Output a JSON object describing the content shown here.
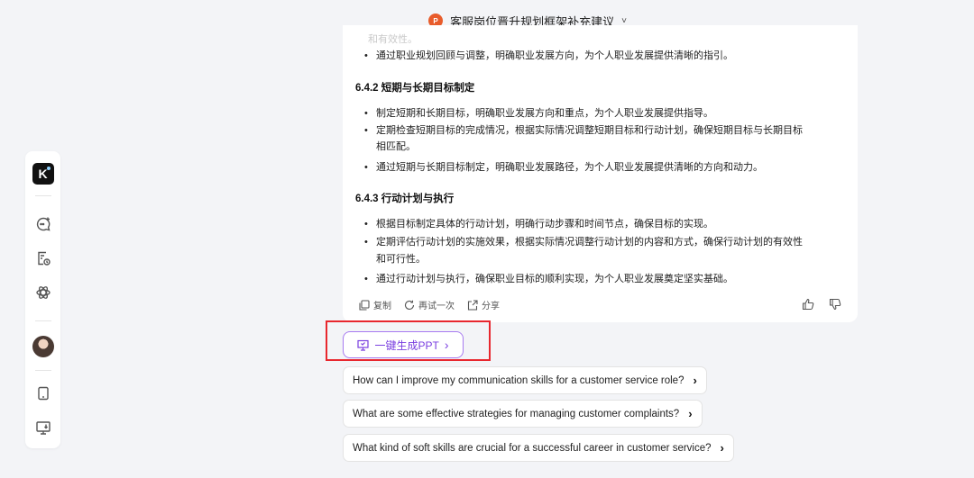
{
  "header": {
    "doc_icon_label": "P",
    "title": "客服岗位晋升规划框架补充建议",
    "chevron": "˅"
  },
  "sidebar": {
    "logo_text": "K"
  },
  "message": {
    "faded_text": "和有效性。",
    "intro_bullet": "通过职业规划回顾与调整，明确职业发展方向，为个人职业发展提供清晰的指引。",
    "sections": [
      {
        "heading": "6.4.2 短期与长期目标制定",
        "bullets": [
          [
            "制定短期和长期目标，明确职业发展方向和重点，为个人职业发展提供指导。"
          ],
          [
            "定期检查短期目标的完成情况，根据实际情况调整短期目标和行动计划，确保短期目标与长期目标",
            "相匹配。"
          ],
          [
            "通过短期与长期目标制定，明确职业发展路径，为个人职业发展提供清晰的方向和动力。"
          ]
        ]
      },
      {
        "heading": "6.4.3 行动计划与执行",
        "bullets": [
          [
            "根据目标制定具体的行动计划，明确行动步骤和时间节点，确保目标的实现。"
          ],
          [
            "定期评估行动计划的实施效果，根据实际情况调整行动计划的内容和方式，确保行动计划的有效性",
            "和可行性。"
          ],
          [
            "通过行动计划与执行，确保职业目标的顺利实现，为个人职业发展奠定坚实基础。"
          ]
        ]
      }
    ],
    "actions": {
      "copy": "复制",
      "retry": "再试一次",
      "share": "分享"
    }
  },
  "ppt_button": {
    "label": "一键生成PPT",
    "arrow": "›"
  },
  "suggestions": [
    "How can I improve my communication skills for a customer service role?",
    "What are some effective strategies for managing customer complaints?",
    "What kind of soft skills are crucial for a successful career in customer service?"
  ],
  "suggestion_arrow": "›",
  "colors": {
    "accent": "#7a3fe0",
    "highlight": "#e8272e",
    "ppt_icon": "#e85c2b"
  }
}
